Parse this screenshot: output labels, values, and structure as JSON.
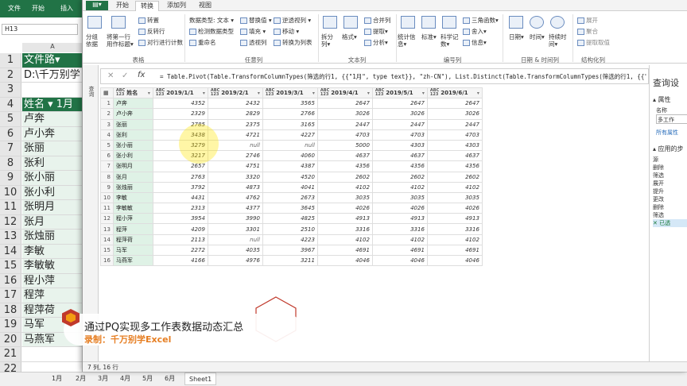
{
  "excel": {
    "tabs": [
      "文件",
      "开始",
      "插入"
    ],
    "namebox": "H13",
    "col_a": "A",
    "rows": [
      {
        "n": "1",
        "v": "文件路▾"
      },
      {
        "n": "2",
        "v": "D:\\千万别学"
      },
      {
        "n": "3",
        "v": ""
      },
      {
        "n": "4",
        "v": "姓名 ▾ 1月"
      },
      {
        "n": "5",
        "v": "卢奔"
      },
      {
        "n": "6",
        "v": "卢小奔"
      },
      {
        "n": "7",
        "v": "张丽"
      },
      {
        "n": "8",
        "v": "张利"
      },
      {
        "n": "9",
        "v": "张小丽"
      },
      {
        "n": "10",
        "v": "张小利"
      },
      {
        "n": "11",
        "v": "张明月"
      },
      {
        "n": "12",
        "v": "张月"
      },
      {
        "n": "13",
        "v": "张烛丽"
      },
      {
        "n": "14",
        "v": "李敏"
      },
      {
        "n": "15",
        "v": "李敏敏"
      },
      {
        "n": "16",
        "v": "程小萍"
      },
      {
        "n": "17",
        "v": "程萍"
      },
      {
        "n": "18",
        "v": "程萍荷"
      },
      {
        "n": "19",
        "v": "马军"
      },
      {
        "n": "20",
        "v": "马燕军"
      },
      {
        "n": "21",
        "v": ""
      },
      {
        "n": "22",
        "v": ""
      }
    ],
    "sheets": [
      "1月",
      "2月",
      "3月",
      "4月",
      "5月",
      "6月",
      "Sheet1"
    ]
  },
  "pq": {
    "file_btn": "▤▾",
    "tabs": [
      "开始",
      "转换",
      "添加列",
      "视图"
    ],
    "ribbon": {
      "group_names": [
        "表格",
        "任意列",
        "文本列",
        "编号列",
        "日期 & 时间列",
        "结构化列"
      ],
      "table_items": [
        "分组依据",
        "将第一行用作标题▾",
        "转置",
        "反转行",
        "对行进行计数"
      ],
      "anycol_items": [
        "数据类型: 文本 ▾",
        "检测数据类型",
        "重命名",
        "替换值 ▾",
        "填充 ▾",
        "透视列",
        "逆透视列 ▾",
        "移动 ▾",
        "转换为列表"
      ],
      "text_items": [
        "拆分列▾",
        "格式▾",
        "合并列",
        "提取▾",
        "分析▾"
      ],
      "num_items": [
        "统计信息▾",
        "标准▾",
        "科学记数▾",
        "三角函数▾",
        "舍入▾",
        "信息▾"
      ],
      "date_items": [
        "日期▾",
        "时间▾",
        "持续时间▾"
      ],
      "struct_items": [
        "展开",
        "聚合",
        "提取取值"
      ]
    },
    "queries_label": "查询",
    "formula": "= Table.Pivot(Table.TransformColumnTypes(筛选的行1, {{\"1月\", type text}}, \"zh-CN\"), List.Distinct(Table.TransformColumnTypes(筛选的行1, {{\"1月\",",
    "fx": "fx",
    "columns": [
      "姓名",
      "2019/1/1",
      "2019/2/1",
      "2019/3/1",
      "2019/4/1",
      "2019/5/1",
      "2019/6/1"
    ],
    "rows": [
      [
        "1",
        "卢奔",
        "4352",
        "2432",
        "3565",
        "2647",
        "2647",
        "2647"
      ],
      [
        "2",
        "卢小奔",
        "2329",
        "2829",
        "2766",
        "3026",
        "3026",
        "3026"
      ],
      [
        "3",
        "张丽",
        "2785",
        "2375",
        "3165",
        "2447",
        "2447",
        "2447"
      ],
      [
        "4",
        "张利",
        "3438",
        "4721",
        "4227",
        "4703",
        "4703",
        "4703"
      ],
      [
        "5",
        "张小丽",
        "3279",
        "null",
        "null",
        "5000",
        "4303",
        "4303"
      ],
      [
        "6",
        "张小利",
        "3217",
        "2746",
        "4060",
        "4637",
        "4637",
        "4637"
      ],
      [
        "7",
        "张明月",
        "2657",
        "4751",
        "4387",
        "4356",
        "4356",
        "4356"
      ],
      [
        "8",
        "张月",
        "2763",
        "3320",
        "4520",
        "2602",
        "2602",
        "2602"
      ],
      [
        "9",
        "张烛丽",
        "3792",
        "4873",
        "4041",
        "4102",
        "4102",
        "4102"
      ],
      [
        "10",
        "李敏",
        "4431",
        "4762",
        "2673",
        "3035",
        "3035",
        "3035"
      ],
      [
        "11",
        "李敏敏",
        "2313",
        "4377",
        "3645",
        "4026",
        "4026",
        "4026"
      ],
      [
        "12",
        "程小萍",
        "3954",
        "3990",
        "4825",
        "4913",
        "4913",
        "4913"
      ],
      [
        "13",
        "程萍",
        "4209",
        "3301",
        "2510",
        "3316",
        "3316",
        "3316"
      ],
      [
        "14",
        "程萍荷",
        "2113",
        "null",
        "4223",
        "4102",
        "4102",
        "4102"
      ],
      [
        "15",
        "马军",
        "2272",
        "4035",
        "3967",
        "4691",
        "4691",
        "4691"
      ],
      [
        "16",
        "马燕军",
        "4166",
        "4976",
        "3211",
        "4046",
        "4046",
        "4046"
      ]
    ],
    "settings": {
      "title": "查询设",
      "props": "▴ 属性",
      "name_label": "名称",
      "name_value": "多工作",
      "all_props": "所有属性",
      "steps_title": "▴ 应用的步",
      "steps": [
        "源",
        "删除",
        "筛选",
        "展开",
        "提升",
        "更改",
        "删除",
        "筛选",
        "✕ 已透"
      ]
    },
    "status": "7 列, 16 行"
  },
  "overlay": {
    "title": "通过PQ实现多工作表数据动态汇总",
    "subtitle": "录制：千万别学Excel"
  },
  "colors": {
    "excel_green": "#217346",
    "name_col": "#dff2e6",
    "accent": "#e67e22"
  }
}
